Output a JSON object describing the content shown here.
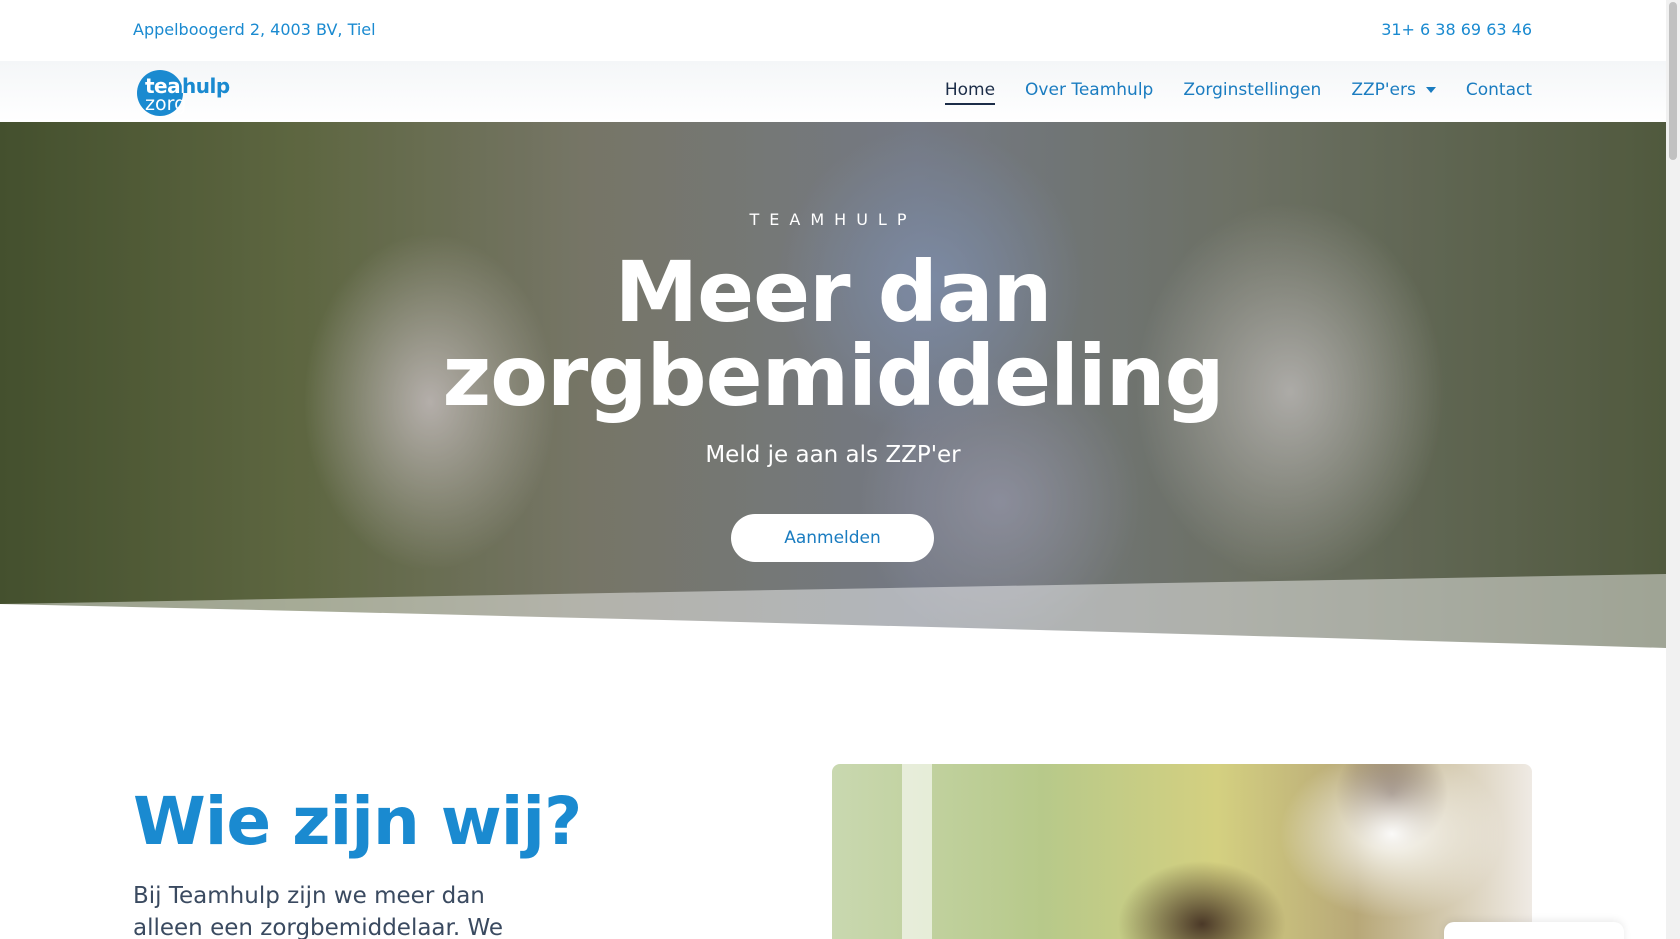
{
  "topbar": {
    "address": "Appelboogerd 2, 4003 BV, Tiel",
    "phone": "31+ 6 38 69 63 46"
  },
  "nav": {
    "logo_line1": "team",
    "logo_line1b": "hulp",
    "logo_line2": "zorg",
    "items": [
      {
        "label": "Home",
        "active": true
      },
      {
        "label": "Over Teamhulp",
        "active": false
      },
      {
        "label": "Zorginstellingen",
        "active": false
      },
      {
        "label": "ZZP'ers",
        "active": false,
        "dropdown": true
      },
      {
        "label": "Contact",
        "active": false
      }
    ]
  },
  "hero": {
    "kicker": "TEAMHULP",
    "headline_line1": "Meer dan",
    "headline_line2": "zorgbemiddeling",
    "subtitle": "Meld je aan als ZZP'er",
    "cta": "Aanmelden"
  },
  "about": {
    "title": "Wie zijn wij?",
    "text": "Bij Teamhulp zijn we meer dan alleen een zorgbemiddelaar. We geloven in"
  },
  "colors": {
    "brand_blue": "#1a8ad0",
    "nav_active": "#1c2d48",
    "body_text": "#3a4a60"
  }
}
